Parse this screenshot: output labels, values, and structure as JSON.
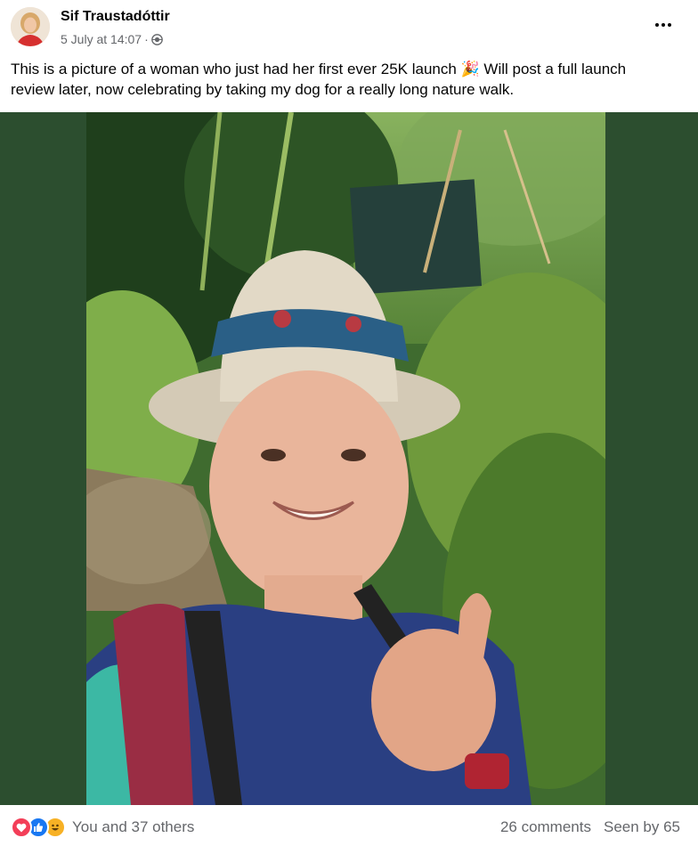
{
  "post": {
    "author": "Sif Traustadóttir",
    "timestamp": "5 July at 14:07",
    "separator": "·",
    "audience_icon": "globe-icon",
    "text_line1": "This is a picture of a woman who just had her first ever 25K launch 🎉 Will post a full launch",
    "text_line2": "review later, now celebrating by taking my dog for a really long nature walk."
  },
  "footer": {
    "reactions": [
      "love-icon",
      "like-icon",
      "haha-icon"
    ],
    "reaction_text": "You and 37 others",
    "comments": "26 comments",
    "seen": "Seen by 65"
  },
  "colors": {
    "photo_backdrop": "#2c4e2f",
    "like": "#1877f2",
    "love": "#f33e58",
    "haha": "#f7b125",
    "secondary_text": "#65676b"
  }
}
